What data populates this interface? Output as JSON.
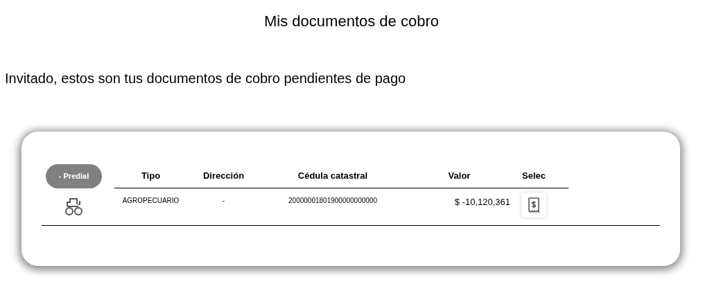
{
  "title": "Mis documentos de cobro",
  "subtitle": "Invitado, estos son tus documentos de cobro pendientes de pago",
  "category": {
    "label": "- Predial"
  },
  "table": {
    "columns": [
      "Tipo",
      "Dirección",
      "Cédula catastral",
      "Valor",
      "Selec"
    ],
    "rows": [
      {
        "cells": [
          "AGROPECUARIO",
          "-",
          "20000001801900000000000",
          "$ -10,120,361"
        ]
      }
    ]
  }
}
